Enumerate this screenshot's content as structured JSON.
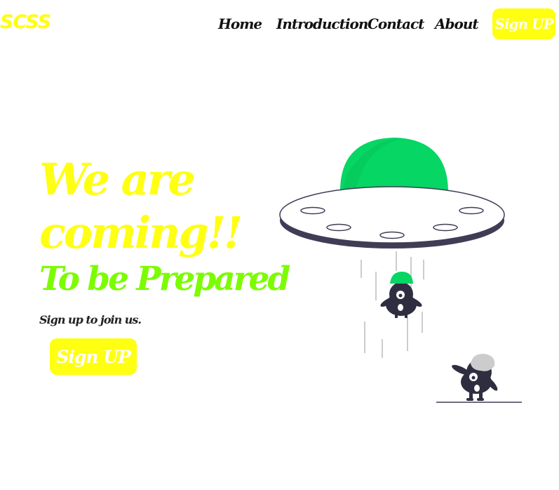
{
  "header": {
    "logo": "SCSS",
    "nav": [
      "Home",
      "Introduction",
      "Contact",
      "About"
    ],
    "signup_label": "Sign UP"
  },
  "hero": {
    "title": "We are coming!!",
    "subtitle": "To be Prepared",
    "caption": "Sign up to join us.",
    "signup_label": "Sign UP"
  },
  "illustration": {
    "name": "ufo-abduction-illustration",
    "colors": {
      "dome": "#06d663",
      "saucer_body": "#ffffff",
      "saucer_rim": "#3f3d56",
      "monster_body": "#2f2e41",
      "monster_helmet_green": "#06d663",
      "monster_helmet_grey": "#cccccc",
      "beam_lines": "#cccccc"
    }
  },
  "theme": {
    "primary_yellow": "#ffff12",
    "accent_green": "#7cfc00",
    "text_dark": "#111111"
  }
}
